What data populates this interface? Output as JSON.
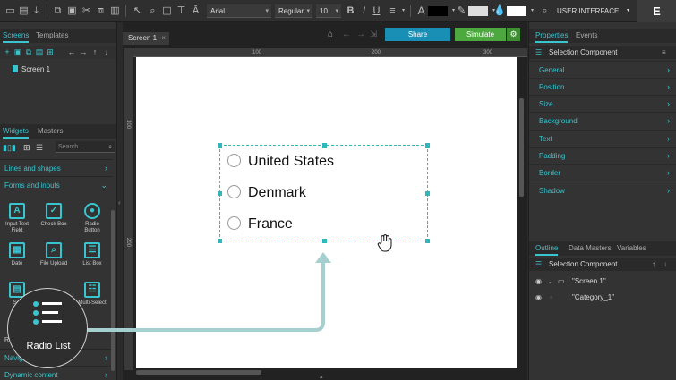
{
  "toolbar": {
    "font_family": "Arial",
    "font_weight": "Regular",
    "font_size": "10",
    "bold": "B",
    "italic": "I",
    "underline": "U",
    "text_color_letter": "A",
    "mode_label": "USER INTERFACE",
    "logo_letter": "E"
  },
  "left_panel": {
    "tabs": [
      "Screens",
      "Templates"
    ],
    "screens": [
      "Screen 1"
    ],
    "widget_tabs": [
      "Widgets",
      "Masters"
    ],
    "search_placeholder": "Search ...",
    "categories": {
      "lines_and_shapes": "Lines and shapes",
      "forms_and_inputs": "Forms and inputs",
      "navigation": "Navig",
      "dynamic_content": "Dynamic content",
      "hidden_row": "Ra"
    },
    "widgets": [
      {
        "label": "Input Text Field",
        "icon": "input-text-icon"
      },
      {
        "label": "Check Box",
        "icon": "check-box-icon"
      },
      {
        "label": "Radio Button",
        "icon": "radio-button-icon"
      },
      {
        "label": "Date",
        "icon": "calendar-icon"
      },
      {
        "label": "File Upload",
        "icon": "file-upload-icon"
      },
      {
        "label": "List Box",
        "icon": "list-box-icon"
      },
      {
        "label": "Sel",
        "icon": "select-icon"
      },
      {
        "label": "Multi-Select",
        "icon": "multi-select-icon"
      }
    ]
  },
  "center": {
    "doc_tab": "Screen 1",
    "share": "Share",
    "simulate": "Simulate",
    "ruler_top": [
      "100",
      "200",
      "300"
    ],
    "ruler_left": [
      "100",
      "200"
    ],
    "radio_options": [
      "United States",
      "Denmark",
      "France"
    ]
  },
  "right_panel": {
    "tabs": [
      "Properties",
      "Events"
    ],
    "selection_title": "Selection Component",
    "properties": [
      "General",
      "Position",
      "Size",
      "Background",
      "Text",
      "Padding",
      "Border",
      "Shadow"
    ],
    "outline_tabs": [
      "Outline",
      "Data Masters",
      "Variables"
    ],
    "outline_selection": "Selection Component",
    "outline_items": [
      "\"Screen 1\"",
      "\"Category_1\""
    ]
  },
  "overlay": {
    "badge_label": "Radio List"
  },
  "colors": {
    "accent": "#39c5cf",
    "share": "#1a8fb5",
    "simulate": "#4ca83f",
    "selection": "#2fb7b9",
    "arrow": "#a6cfcf"
  }
}
